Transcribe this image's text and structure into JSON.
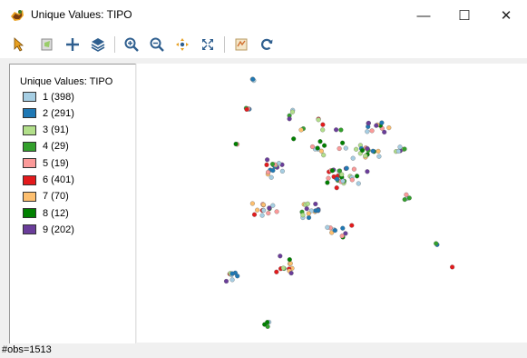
{
  "window": {
    "title": "Unique Values: TIPO",
    "minimize": "—",
    "maximize": "☐",
    "close": "✕"
  },
  "toolbar": {
    "tools": [
      "select-tool",
      "select-by-polygon",
      "add-point",
      "layers",
      "zoom-in",
      "zoom-out",
      "pan",
      "full-extent",
      "map-legend",
      "refresh"
    ]
  },
  "legend": {
    "title": "Unique Values: TIPO",
    "items": [
      {
        "label": "1 (398)",
        "color": "#a6cee3"
      },
      {
        "label": "2 (291)",
        "color": "#1f78b4"
      },
      {
        "label": "3 (91)",
        "color": "#b2df8a"
      },
      {
        "label": "4 (29)",
        "color": "#33a02c"
      },
      {
        "label": "5 (19)",
        "color": "#fb9a99"
      },
      {
        "label": "6 (401)",
        "color": "#e31a1c"
      },
      {
        "label": "7 (70)",
        "color": "#fdbf6f"
      },
      {
        "label": "8 (12)",
        "color": "#008000"
      },
      {
        "label": "9 (202)",
        "color": "#6a3d9a"
      }
    ]
  },
  "status": {
    "text": "#obs=1513"
  }
}
